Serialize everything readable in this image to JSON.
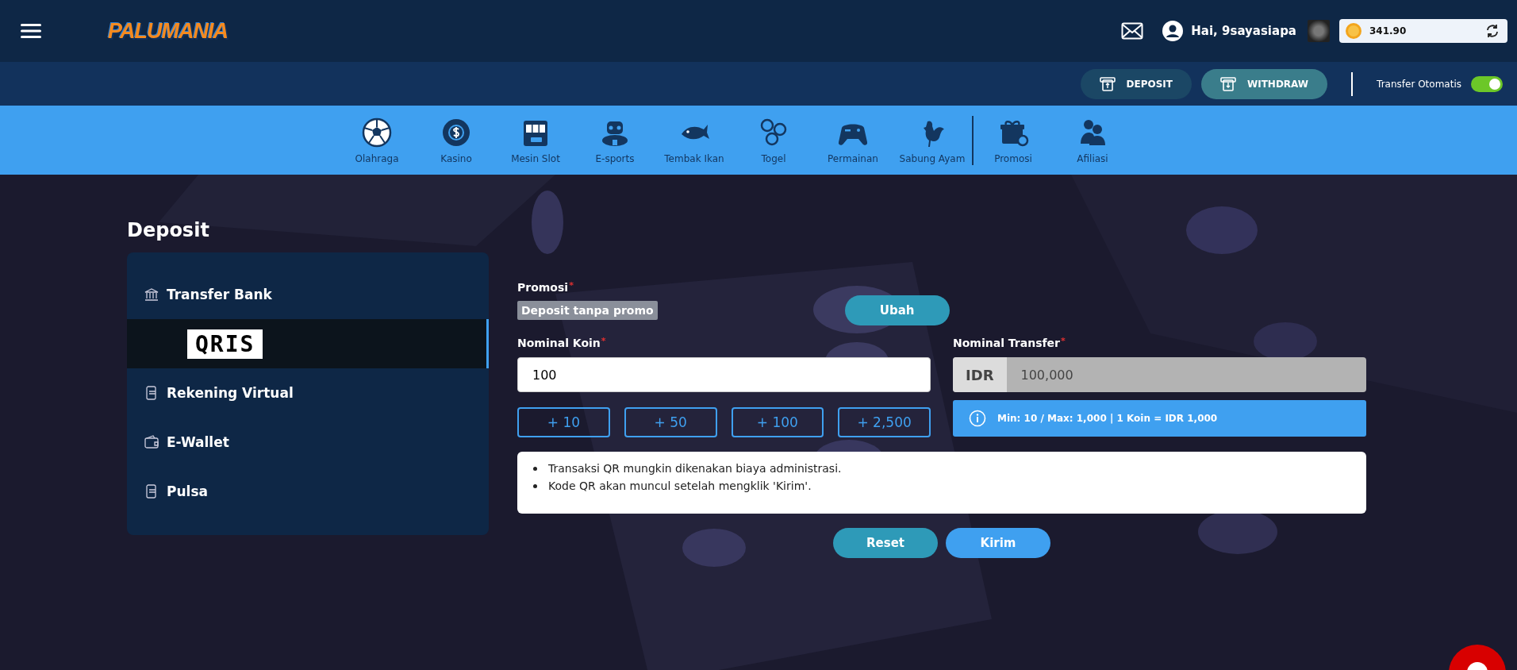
{
  "header": {
    "logo": "PALUMANIA",
    "greeting": "Hai, 9sayasiapa",
    "balance": "341.90"
  },
  "actions": {
    "buttons": [
      {
        "label": "DEPOSIT",
        "kind": "deposit"
      },
      {
        "label": "WITHDRAW",
        "kind": "withdraw"
      }
    ],
    "auto_transfer": {
      "label": "Transfer Otomatis",
      "on": true
    }
  },
  "nav": [
    {
      "label": "Olahraga",
      "kind": "ball"
    },
    {
      "label": "Kasino",
      "kind": "chip"
    },
    {
      "label": "Mesin Slot",
      "kind": "slot"
    },
    {
      "label": "E-sports",
      "kind": "esports"
    },
    {
      "label": "Tembak Ikan",
      "kind": "fish"
    },
    {
      "label": "Togel",
      "kind": "balls"
    },
    {
      "label": "Permainan",
      "kind": "gamepad"
    },
    {
      "label": "Sabung Ayam",
      "kind": "rooster",
      "divider_after": true
    },
    {
      "label": "Promosi",
      "kind": "gift"
    },
    {
      "label": "Afiliasi",
      "kind": "people"
    }
  ],
  "page_title": "Deposit",
  "methods": [
    {
      "label": "Transfer Bank",
      "kind": "bank",
      "selected": false
    },
    {
      "label": "QRIS",
      "kind": "qris",
      "selected": true
    },
    {
      "label": "Rekening Virtual",
      "kind": "virtual",
      "selected": false
    },
    {
      "label": "E-Wallet",
      "kind": "wallet",
      "selected": false
    },
    {
      "label": "Pulsa",
      "kind": "pulsa",
      "selected": false
    }
  ],
  "form": {
    "required_mark": "*",
    "promo_label": "Promosi",
    "promo_value": "Deposit tanpa promo",
    "change_button": "Ubah",
    "coin_label": "Nominal Koin",
    "coin_value": "100",
    "quick_amounts": [
      "+ 10",
      "+ 50",
      "+ 100",
      "+ 2,500"
    ],
    "transfer_label": "Nominal Transfer",
    "currency": "IDR",
    "transfer_value": "100,000",
    "info": "Min: 10 / Max: 1,000 | 1 Koin = IDR 1,000",
    "notes": [
      "Transaksi QR mungkin dikenakan biaya administrasi.",
      "Kode QR akan muncul setelah mengklik 'Kirim'."
    ],
    "reset_button": "Reset",
    "submit_button": "Kirim"
  }
}
